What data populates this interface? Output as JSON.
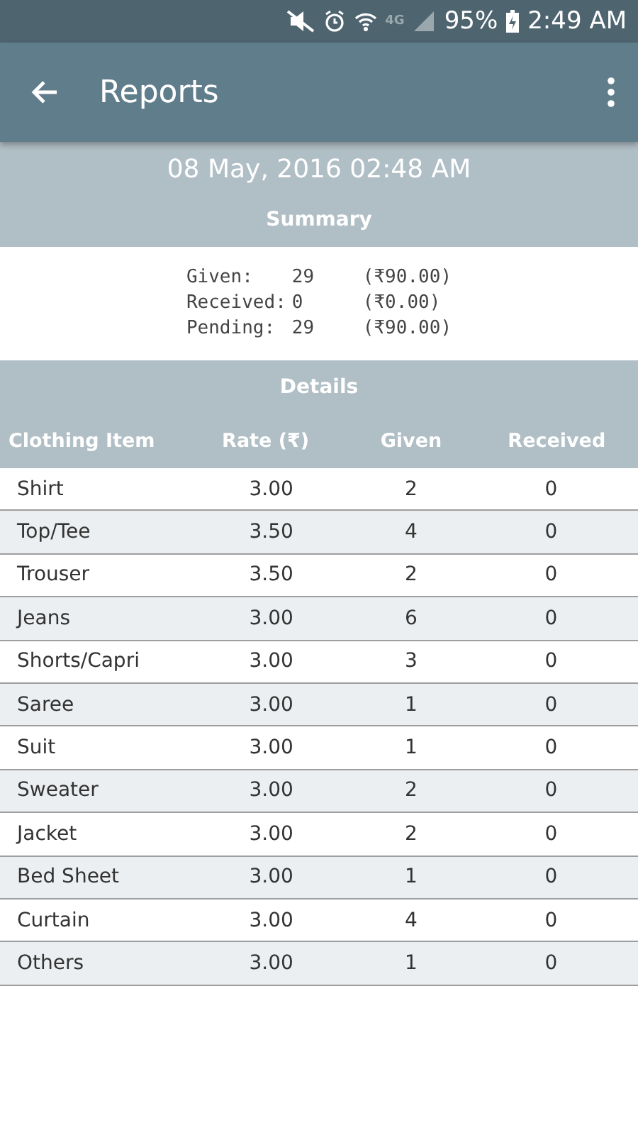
{
  "status_bar": {
    "network_type": "4G",
    "battery": "95%",
    "time": "2:49 AM"
  },
  "app_bar": {
    "title": "Reports"
  },
  "report_date": "08 May, 2016 02:48 AM",
  "summary": {
    "title": "Summary",
    "lines": [
      {
        "label": "Given:",
        "count": "29",
        "amount": "(₹90.00)"
      },
      {
        "label": "Received:",
        "count": "0",
        "amount": "(₹0.00)"
      },
      {
        "label": "Pending:",
        "count": "29",
        "amount": "(₹90.00)"
      }
    ]
  },
  "details": {
    "title": "Details",
    "columns": [
      "Clothing Item",
      "Rate (₹)",
      "Given",
      "Received"
    ],
    "rows": [
      [
        "Shirt",
        "3.00",
        "2",
        "0"
      ],
      [
        "Top/Tee",
        "3.50",
        "4",
        "0"
      ],
      [
        "Trouser",
        "3.50",
        "2",
        "0"
      ],
      [
        "Jeans",
        "3.00",
        "6",
        "0"
      ],
      [
        "Shorts/Capri",
        "3.00",
        "3",
        "0"
      ],
      [
        "Saree",
        "3.00",
        "1",
        "0"
      ],
      [
        "Suit",
        "3.00",
        "1",
        "0"
      ],
      [
        "Sweater",
        "3.00",
        "2",
        "0"
      ],
      [
        "Jacket",
        "3.00",
        "2",
        "0"
      ],
      [
        "Bed Sheet",
        "3.00",
        "1",
        "0"
      ],
      [
        "Curtain",
        "3.00",
        "4",
        "0"
      ],
      [
        "Others",
        "3.00",
        "1",
        "0"
      ]
    ]
  }
}
